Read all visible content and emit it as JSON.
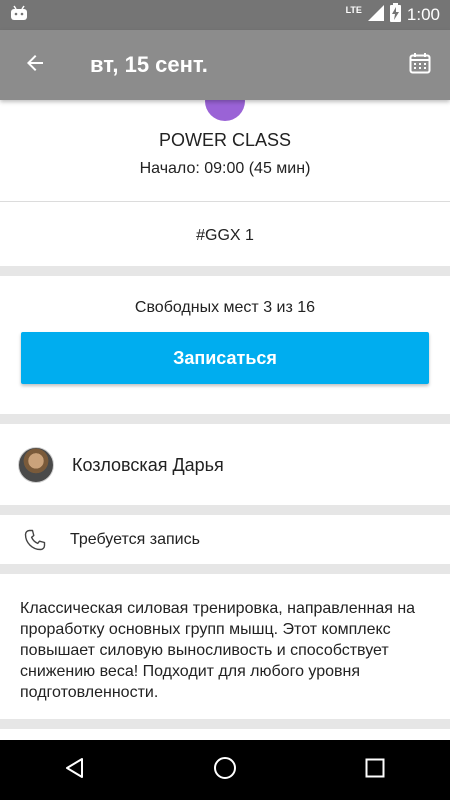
{
  "status_bar": {
    "network": "LTE",
    "time": "1:00",
    "icons": [
      "android-icon",
      "lte-icon",
      "signal-icon",
      "battery-charging-icon"
    ]
  },
  "toolbar": {
    "title": "вт, 15 сент.",
    "back_icon": "arrow-left-icon",
    "calendar_icon": "calendar-icon"
  },
  "class_info": {
    "name": "POWER CLASS",
    "start": "Начало: 09:00 (45 мин)",
    "tag": "#GGX 1",
    "accent_color": "#9a63d6"
  },
  "booking": {
    "free_places": "Свободных мест 3 из 16",
    "button_label": "Записаться",
    "button_color": "#00adef"
  },
  "trainer": {
    "name": "Козловская Дарья"
  },
  "requirement": {
    "icon": "phone-icon",
    "text": "Требуется запись"
  },
  "description": "Классическая силовая тренировка, направленная на проработку основных групп мышц. Этот комплекс повышает силовую выносливость и способствует снижению веса! Подходит для любого уровня подготовленности.",
  "nav_bar": {
    "buttons": [
      "back-triangle-icon",
      "home-circle-icon",
      "recents-square-icon"
    ]
  }
}
